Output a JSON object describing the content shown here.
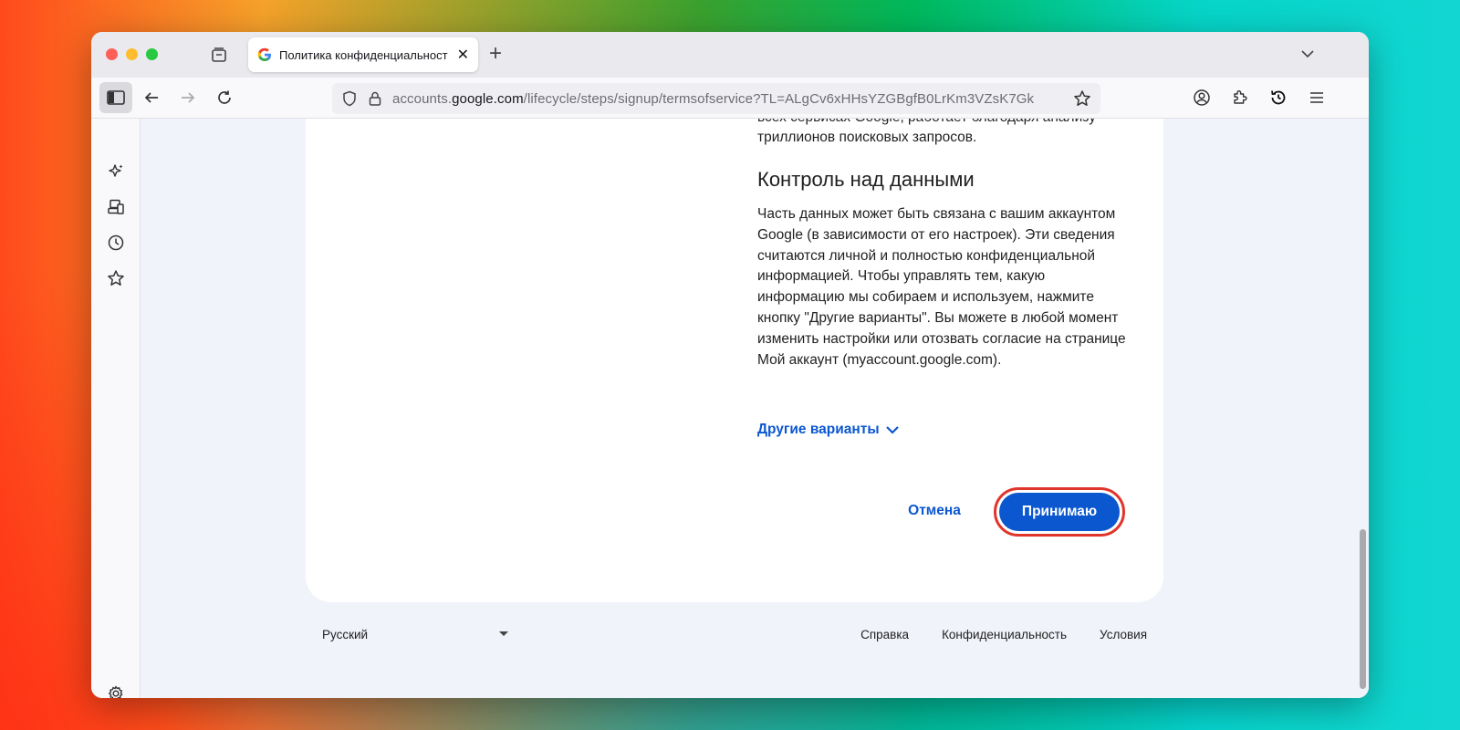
{
  "browser": {
    "tab": {
      "title": "Политика конфиденциальност",
      "close": "✕"
    },
    "new_tab": "+",
    "url": {
      "prefix": "accounts.",
      "domain": "google.com",
      "path": "/lifecycle/steps/signup/termsofservice?TL=ALgCv6xHHsYZGBgfB0LrKm3VZsK7Gk"
    }
  },
  "page": {
    "cut_line_1": "всех сервисах Google, работает благодаря анализу",
    "cut_line_2": "триллионов поисковых запросов.",
    "section_title": "Контроль над данными",
    "body": "Часть данных может быть связана с вашим аккаунтом Google (в зависимости от его настроек). Эти сведения считаются личной и полностью конфиденциальной информацией. Чтобы управлять тем, какую информацию мы собираем и используем, нажмите кнопку \"Другие варианты\". Вы можете в любой момент изменить настройки или отозвать согласие на странице Мой аккаунт (myaccount.google.com).",
    "more_options": "Другие варианты",
    "cancel": "Отмена",
    "accept": "Принимаю"
  },
  "footer": {
    "language": "Русский",
    "links": [
      "Справка",
      "Конфиденциальность",
      "Условия"
    ]
  },
  "colors": {
    "accent": "#0b57d0",
    "highlight": "#e0352b"
  }
}
